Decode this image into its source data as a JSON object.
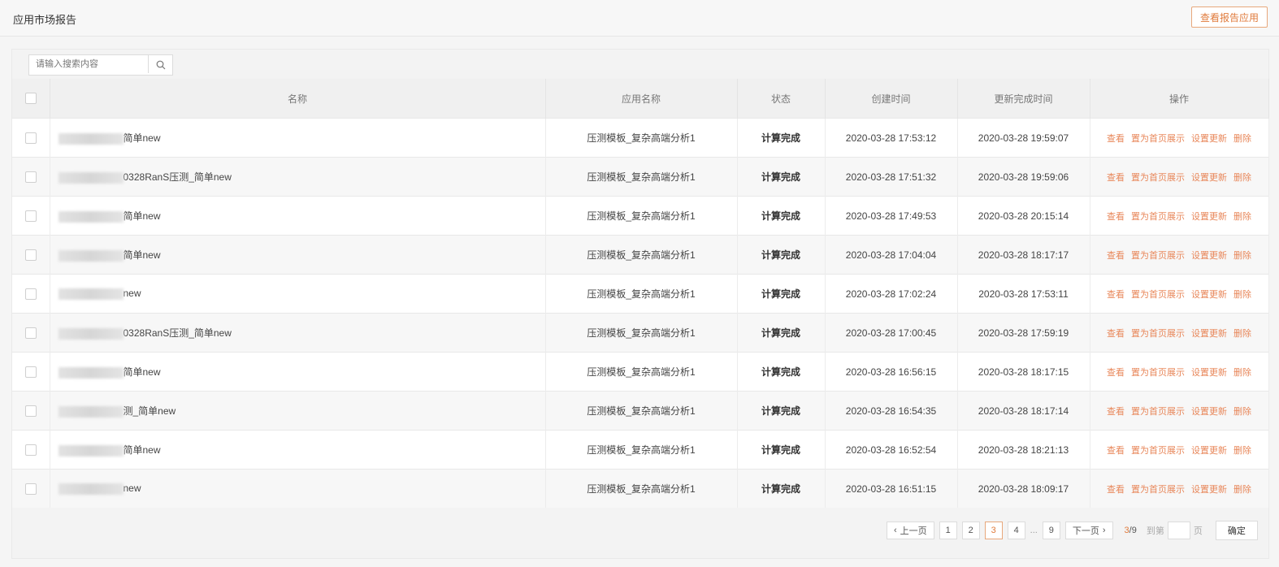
{
  "header": {
    "title": "应用市场报告",
    "view_button": "查看报告应用"
  },
  "search": {
    "placeholder": "请输入搜索内容"
  },
  "columns": {
    "name": "名称",
    "app_name": "应用名称",
    "status": "状态",
    "created": "创建时间",
    "updated": "更新完成时间",
    "ops": "操作"
  },
  "actions": {
    "view": "查看",
    "set_home": "置为首页展示",
    "set_update": "设置更新",
    "delete": "删除"
  },
  "rows": [
    {
      "name": "简单new",
      "app": "压测模板_复杂高端分析1",
      "status": "计算完成",
      "created": "2020-03-28 17:53:12",
      "updated": "2020-03-28 19:59:07"
    },
    {
      "name": "0328RanS压测_简单new",
      "app": "压测模板_复杂高端分析1",
      "status": "计算完成",
      "created": "2020-03-28 17:51:32",
      "updated": "2020-03-28 19:59:06"
    },
    {
      "name": "简单new",
      "app": "压测模板_复杂高端分析1",
      "status": "计算完成",
      "created": "2020-03-28 17:49:53",
      "updated": "2020-03-28 20:15:14"
    },
    {
      "name": "简单new",
      "app": "压测模板_复杂高端分析1",
      "status": "计算完成",
      "created": "2020-03-28 17:04:04",
      "updated": "2020-03-28 18:17:17"
    },
    {
      "name": "new",
      "app": "压测模板_复杂高端分析1",
      "status": "计算完成",
      "created": "2020-03-28 17:02:24",
      "updated": "2020-03-28 17:53:11"
    },
    {
      "name": "0328RanS压测_简单new",
      "app": "压测模板_复杂高端分析1",
      "status": "计算完成",
      "created": "2020-03-28 17:00:45",
      "updated": "2020-03-28 17:59:19"
    },
    {
      "name": "简单new",
      "app": "压测模板_复杂高端分析1",
      "status": "计算完成",
      "created": "2020-03-28 16:56:15",
      "updated": "2020-03-28 18:17:15"
    },
    {
      "name": "测_简单new",
      "app": "压测模板_复杂高端分析1",
      "status": "计算完成",
      "created": "2020-03-28 16:54:35",
      "updated": "2020-03-28 18:17:14"
    },
    {
      "name": "简单new",
      "app": "压测模板_复杂高端分析1",
      "status": "计算完成",
      "created": "2020-03-28 16:52:54",
      "updated": "2020-03-28 18:21:13"
    },
    {
      "name": "new",
      "app": "压测模板_复杂高端分析1",
      "status": "计算完成",
      "created": "2020-03-28 16:51:15",
      "updated": "2020-03-28 18:09:17"
    }
  ],
  "pagination": {
    "prev": "上一页",
    "next": "下一页",
    "pages": [
      "1",
      "2",
      "3",
      "4",
      "9"
    ],
    "ellipsis": "...",
    "current": "3",
    "total": "/9",
    "goto_prefix": "到第",
    "goto_suffix": "页",
    "confirm": "确定"
  }
}
